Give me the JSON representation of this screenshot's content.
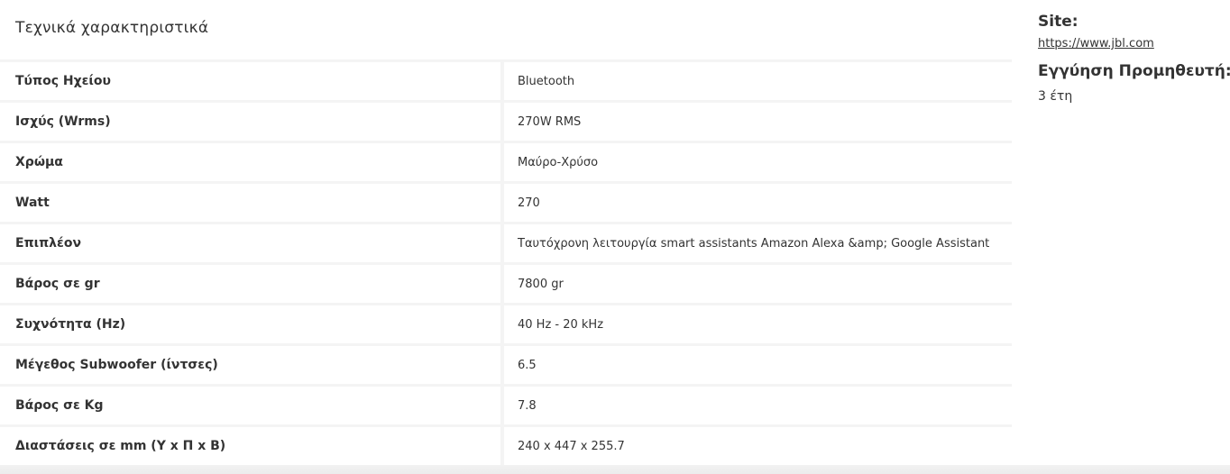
{
  "specs": {
    "title": "Τεχνικά χαρακτηριστικά",
    "rows": [
      {
        "label": "Τύπος Ηχείου",
        "value": "Bluetooth"
      },
      {
        "label": "Ισχύς (Wrms)",
        "value": "270W RMS"
      },
      {
        "label": "Χρώμα",
        "value": "Μαύρο-Χρύσο"
      },
      {
        "label": "Watt",
        "value": "270"
      },
      {
        "label": "Επιπλέον",
        "value": "Ταυτόχρονη λειτουργία smart assistants Amazon Alexa &amp; Google Assistant"
      },
      {
        "label": "Βάρος σε gr",
        "value": "7800 gr"
      },
      {
        "label": "Συχνότητα (Hz)",
        "value": "40 Hz - 20 kHz"
      },
      {
        "label": "Μέγεθος Subwoofer (ίντσες)",
        "value": "6.5"
      },
      {
        "label": "Βάρος σε Kg",
        "value": "7.8"
      },
      {
        "label": "Διαστάσεις σε mm (Υ x Π x Β)",
        "value": "240 x 447 x 255.7"
      }
    ]
  },
  "sidebar": {
    "site_heading": "Site:",
    "site_link": "https://www.jbl.com",
    "warranty_heading": "Εγγύηση Προμηθευτή:",
    "warranty_value": "3 έτη"
  }
}
